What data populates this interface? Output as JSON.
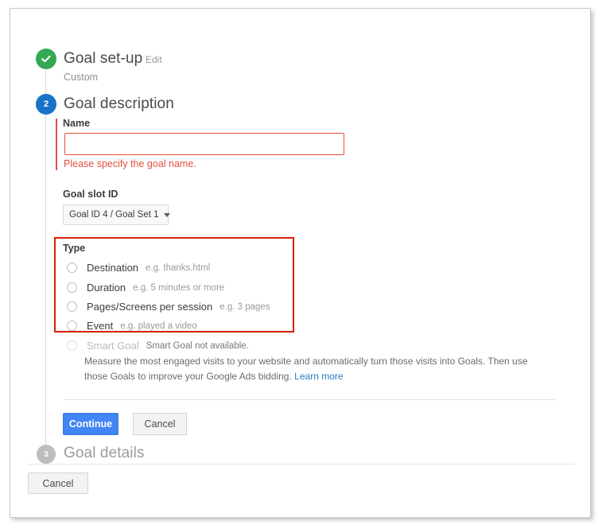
{
  "steps": {
    "setup": {
      "marker": "check-icon",
      "title": "Goal set-up",
      "edit_label": "Edit",
      "subtitle": "Custom"
    },
    "description": {
      "marker": "2",
      "title": "Goal description"
    },
    "details": {
      "marker": "3",
      "title": "Goal details"
    }
  },
  "form": {
    "name": {
      "label": "Name",
      "value": "",
      "placeholder": "",
      "error": "Please specify the goal name.",
      "error_color": "#e25141"
    },
    "goal_slot": {
      "label": "Goal slot ID",
      "selected": "Goal ID 4 / Goal Set 1",
      "caret_icon": "chevron-down-icon"
    },
    "type": {
      "label": "Type",
      "options": [
        {
          "label": "Destination",
          "hint": "e.g. thanks.html",
          "selected": false,
          "disabled": false
        },
        {
          "label": "Duration",
          "hint": "e.g. 5 minutes or more",
          "selected": false,
          "disabled": false
        },
        {
          "label": "Pages/Screens per session",
          "hint": "e.g. 3 pages",
          "selected": false,
          "disabled": false
        },
        {
          "label": "Event",
          "hint": "e.g. played a video",
          "selected": false,
          "disabled": false
        },
        {
          "label": "Smart Goal",
          "hint": "Smart Goal not available.",
          "selected": false,
          "disabled": true
        }
      ]
    },
    "smart_goal_description": {
      "text": "Measure the most engaged visits to your website and automatically turn those visits into Goals. Then use those Goals to improve your Google Ads bidding.",
      "link_label": "Learn more",
      "link_color": "#2b7bc0"
    }
  },
  "actions": {
    "continue_label": "Continue",
    "cancel_step_label": "Cancel",
    "cancel_page_label": "Cancel"
  },
  "colors": {
    "primary_blue": "#4285f4",
    "step_done_green": "#34a853",
    "step_active_blue": "#1a73c8",
    "step_todo_gray": "#bdbdbd",
    "annotation_red": "#d81e05",
    "error_red": "#e25141"
  }
}
